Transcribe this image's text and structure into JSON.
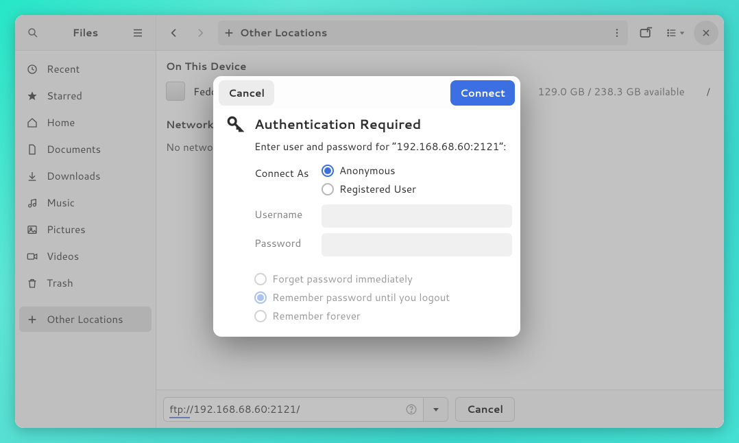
{
  "header": {
    "title": "Files",
    "location_label": "Other Locations"
  },
  "sidebar": {
    "items": [
      {
        "label": "Recent"
      },
      {
        "label": "Starred"
      },
      {
        "label": "Home"
      },
      {
        "label": "Documents"
      },
      {
        "label": "Downloads"
      },
      {
        "label": "Music"
      },
      {
        "label": "Pictures"
      },
      {
        "label": "Videos"
      },
      {
        "label": "Trash"
      },
      {
        "label": "Other Locations"
      }
    ]
  },
  "main": {
    "section_device": "On This Device",
    "device_name": "Fedora Linux",
    "device_size": "129.0 GB / 238.3 GB available",
    "device_mount": "/",
    "section_networks": "Networks",
    "no_networks": "No networks found"
  },
  "connect_bar": {
    "address": "ftp://192.168.68.60:2121/",
    "cancel": "Cancel"
  },
  "dialog": {
    "cancel": "Cancel",
    "connect": "Connect",
    "title": "Authentication Required",
    "subtitle": "Enter user and password for “192.168.68.60:2121”:",
    "connect_as_label": "Connect As",
    "opt_anonymous": "Anonymous",
    "opt_registered": "Registered User",
    "username_label": "Username",
    "password_label": "Password",
    "pw_forget": "Forget password immediately",
    "pw_session": "Remember password until you logout",
    "pw_forever": "Remember forever"
  }
}
